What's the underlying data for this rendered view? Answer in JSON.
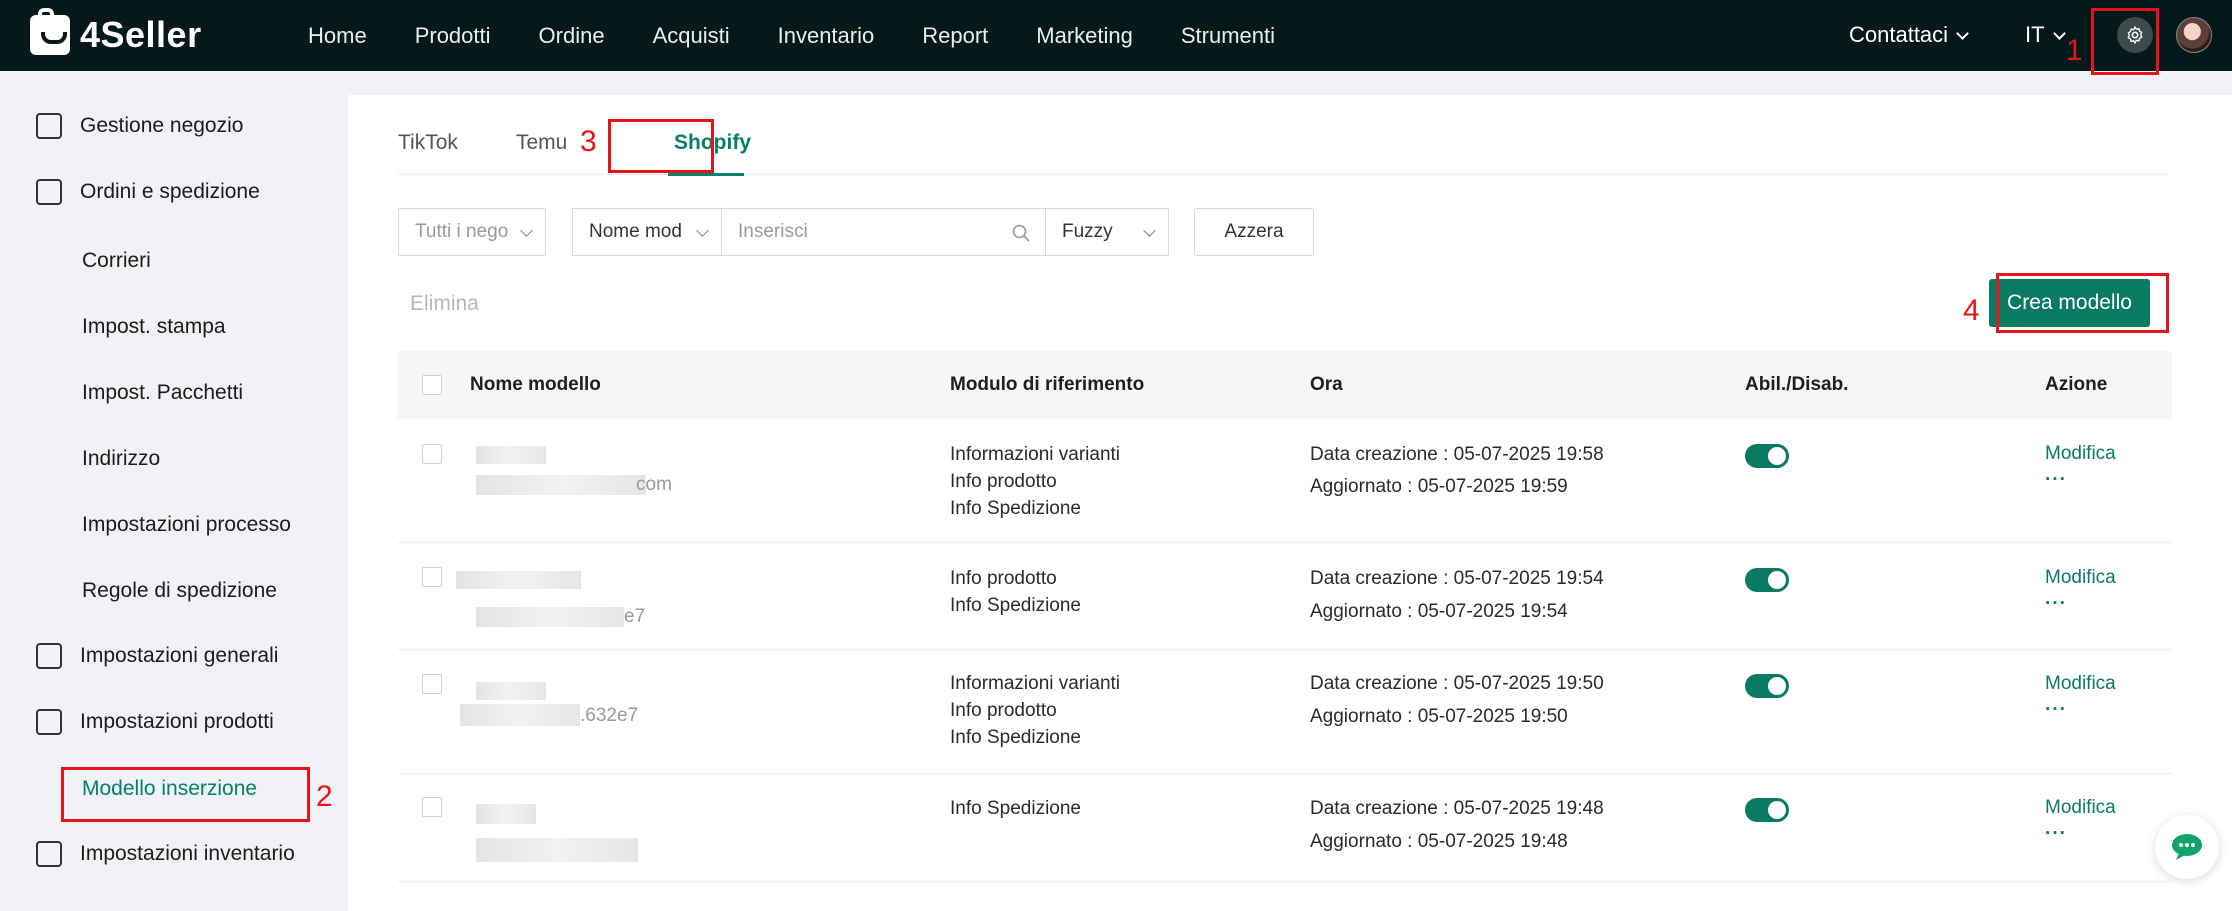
{
  "brand": {
    "name": "4Seller"
  },
  "nav": {
    "items": [
      "Home",
      "Prodotti",
      "Ordine",
      "Acquisti",
      "Inventario",
      "Report",
      "Marketing",
      "Strumenti"
    ]
  },
  "header": {
    "contact": "Contattaci",
    "language": "IT"
  },
  "annotations": [
    "1",
    "2",
    "3",
    "4"
  ],
  "sidebar": {
    "groups": [
      {
        "label": "Gestione negozio",
        "icon": "store-icon"
      },
      {
        "label": "Ordini e spedizione",
        "icon": "clipboard-icon"
      },
      {
        "label": "Impostazioni generali",
        "icon": "printer-icon"
      },
      {
        "label": "Impostazioni prodotti",
        "icon": "upload-box-icon"
      },
      {
        "label": "Impostazioni inventario",
        "icon": "warehouse-icon"
      }
    ],
    "sub_items": [
      "Corrieri",
      "Impost. stampa",
      "Impost. Pacchetti",
      "Indirizzo",
      "Impostazioni processo",
      "Regole di spedizione"
    ],
    "active_item": "Modello inserzione"
  },
  "tabs": [
    "TikTok",
    "Temu",
    "Shopify"
  ],
  "filters": {
    "store_placeholder": "Tutti i nego",
    "field_select": "Nome mod",
    "search_placeholder": "Inserisci",
    "match_mode": "Fuzzy",
    "reset_label": "Azzera"
  },
  "actions": {
    "delete_label": "Elimina",
    "create_label": "Crea modello"
  },
  "table": {
    "headers": [
      "Nome modello",
      "Modulo di riferimento",
      "Ora",
      "Abil./Disab.",
      "Azione"
    ],
    "rows": [
      {
        "name_suffix": "com",
        "modules": [
          "Informazioni varianti",
          "Info prodotto",
          "Info Spedizione"
        ],
        "created": "Data creazione : 05-07-2025 19:58",
        "updated": "Aggiornato : 05-07-2025 19:59",
        "enabled": true
      },
      {
        "name_suffix": "e7",
        "modules": [
          "Info prodotto",
          "Info Spedizione"
        ],
        "created": "Data creazione : 05-07-2025 19:54",
        "updated": "Aggiornato : 05-07-2025 19:54",
        "enabled": true
      },
      {
        "name_suffix": ".632e7",
        "modules": [
          "Informazioni varianti",
          "Info prodotto",
          "Info Spedizione"
        ],
        "created": "Data creazione : 05-07-2025 19:50",
        "updated": "Aggiornato : 05-07-2025 19:50",
        "enabled": true
      },
      {
        "name_suffix": "",
        "modules": [
          "Info Spedizione"
        ],
        "created": "Data creazione : 05-07-2025 19:48",
        "updated": "Aggiornato : 05-07-2025 19:48",
        "enabled": true
      }
    ],
    "action_edit": "Modifica",
    "action_more": "···"
  },
  "colors": {
    "accent": "#0a7a63",
    "topbar": "#06191a",
    "annotation": "#e5141a"
  }
}
